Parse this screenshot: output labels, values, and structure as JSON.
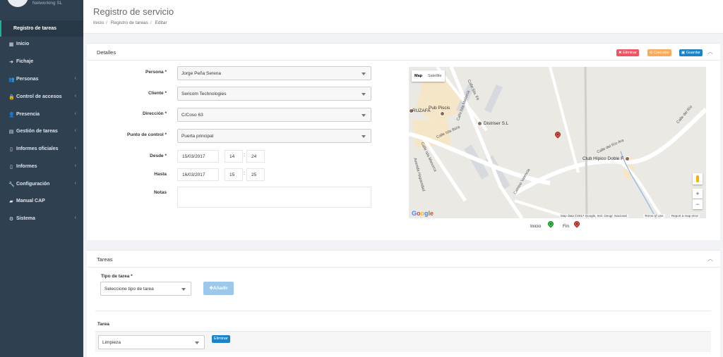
{
  "brand": {
    "name": "Networking SL"
  },
  "sidebar": {
    "active": "Registro de tareas",
    "items": [
      {
        "icon": "grid-icon",
        "glyph": "▦",
        "label": "Inicio",
        "chevron": false
      },
      {
        "icon": "sign-in-icon",
        "glyph": "➜",
        "label": "Fichaje",
        "chevron": false
      },
      {
        "icon": "users-icon",
        "glyph": "👥",
        "label": "Personas",
        "chevron": true
      },
      {
        "icon": "lock-icon",
        "glyph": "🔒",
        "label": "Control de accesos",
        "chevron": true
      },
      {
        "icon": "user-icon",
        "glyph": "👤",
        "label": "Presencia",
        "chevron": true
      },
      {
        "icon": "list-icon",
        "glyph": "▤",
        "label": "Gestión de tareas",
        "chevron": true
      },
      {
        "icon": "file-icon",
        "glyph": "▯",
        "label": "Informes oficiales",
        "chevron": true
      },
      {
        "icon": "file-icon",
        "glyph": "▯",
        "label": "Informes",
        "chevron": true
      },
      {
        "icon": "wrench-icon",
        "glyph": "🔧",
        "label": "Configuración",
        "chevron": true
      },
      {
        "icon": "book-icon",
        "glyph": "▰",
        "label": "Manual CAP",
        "chevron": false
      },
      {
        "icon": "gear-icon",
        "glyph": "⚙",
        "label": "Sistema",
        "chevron": true
      }
    ]
  },
  "header": {
    "title": "Registro de servicio",
    "breadcrumb": [
      "Inicio",
      "Registro de tareas",
      "Editar"
    ]
  },
  "detalles": {
    "title": "Detalles",
    "buttons": {
      "delete": "✖ Eliminar",
      "cancel": "⊘ Cancelar",
      "save": "▣ Guardar"
    },
    "persona": {
      "label": "Persona *",
      "value": "Jorge Peña Serena"
    },
    "cliente": {
      "label": "Cliente *",
      "value": "Sericom Technologies"
    },
    "direccion": {
      "label": "Dirección *",
      "value": "C/Coso 63"
    },
    "punto": {
      "label": "Punto de control *",
      "value": "Puerta principal"
    },
    "desde": {
      "label": "Desde *",
      "date": "15/03/2017",
      "hour": "14",
      "minute": "24"
    },
    "hasta": {
      "label": "Hasta",
      "date": "16/03/2017",
      "hour": "15",
      "minute": "25"
    },
    "notas": {
      "label": "Notas",
      "value": ""
    }
  },
  "map": {
    "types": [
      "Map",
      "Satellite"
    ],
    "pois": [
      "Pub Piscis",
      "RUZAFA",
      "Distriser S.L",
      "Club Hípico Doble F"
    ],
    "streets": [
      "Calle Sta. Fé",
      "Calle Isla Mallorca",
      "Calle Isla Ibiza",
      "Calle Isla Menorca",
      "Avenida Hispanidad",
      "Camino Valencia",
      "Calle del Río Ara",
      "Calle del Río"
    ],
    "zoom_in": "+",
    "zoom_out": "−",
    "attribution": [
      "Map data ©2017 Google, Inst. Geogr. Nacional",
      "Terms of Use",
      "Report a map error"
    ],
    "logo": [
      "G",
      "o",
      "o",
      "g",
      "l",
      "e"
    ],
    "legend": {
      "start": "Inicio",
      "end": "Fin"
    },
    "colors": {
      "start": "#2ecc40",
      "end": "#e74c3c"
    }
  },
  "tareas": {
    "title": "Tareas",
    "tipo_label": "Tipo de tarea *",
    "tipo_placeholder": "Seleccione tipo de tarea",
    "add_label": "✚Añadir",
    "col_header": "Tarea",
    "rows": [
      {
        "value": "Limpieza",
        "delete": "Eliminar"
      }
    ]
  }
}
